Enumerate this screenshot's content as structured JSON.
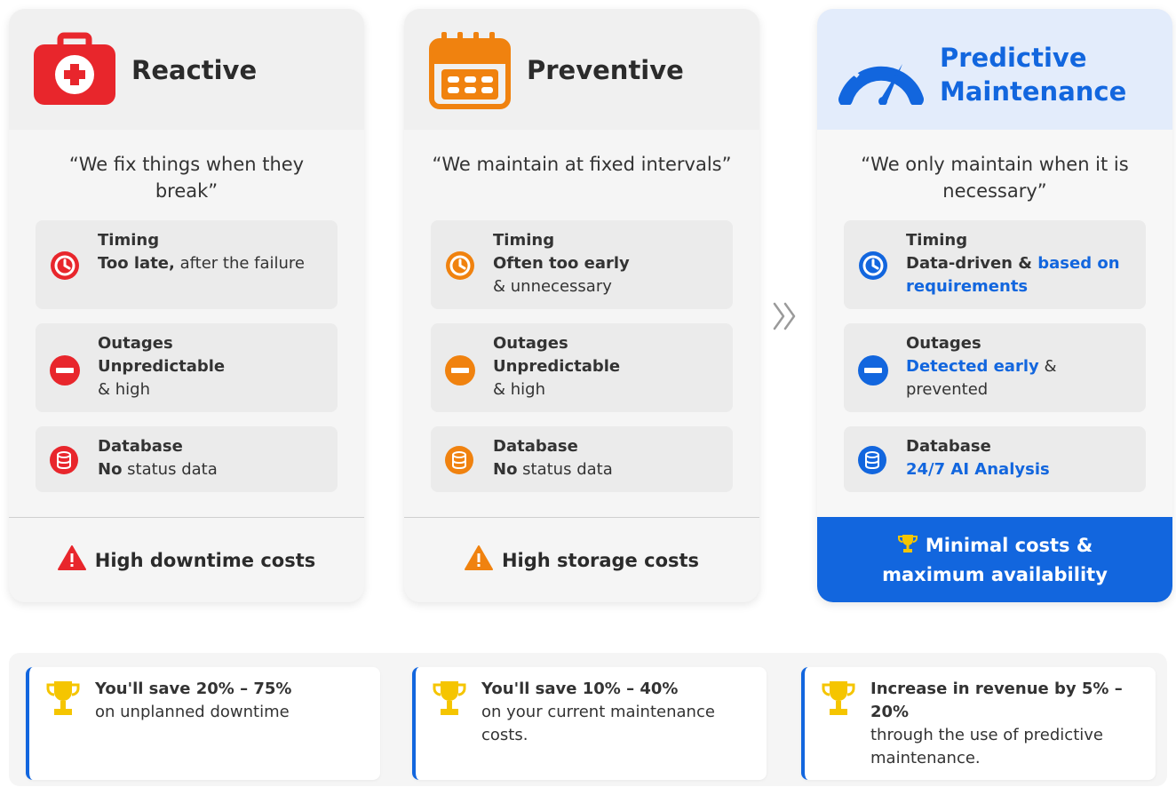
{
  "colors": {
    "reactive": "#e8262c",
    "preventive": "#f0820f",
    "predictive": "#1266de"
  },
  "cards": [
    {
      "title": "Reactive",
      "icon": "first-aid-kit-icon",
      "quote": "“We fix things when they break”",
      "timing": {
        "label": "Timing",
        "strong": "Too late,",
        "rest": " after the failure"
      },
      "outages": {
        "label": "Outages",
        "strong": "Unpredictable",
        "rest": "& high"
      },
      "database": {
        "label": "Database",
        "strong": "No",
        "rest": " status data"
      },
      "footer": "High downtime costs"
    },
    {
      "title": "Preventive",
      "icon": "calendar-icon",
      "quote": "“We maintain at fixed intervals”",
      "timing": {
        "label": "Timing",
        "strong": "Often too early",
        "rest": "& unnecessary"
      },
      "outages": {
        "label": "Outages",
        "strong": "Unpredictable",
        "rest": "& high"
      },
      "database": {
        "label": "Database",
        "strong": "No",
        "rest": " status data"
      },
      "footer": "High storage costs"
    },
    {
      "title_line1": "Predictive",
      "title_line2": "Maintenance",
      "icon": "speedometer-icon",
      "quote": "“We only maintain when it is necessary”",
      "timing": {
        "label": "Timing",
        "strong": "Data-driven & ",
        "blue": "based on requirements"
      },
      "outages": {
        "label": "Outages",
        "blue": "Detected early",
        "rest": " & prevented"
      },
      "database": {
        "label": "Database",
        "blue": "24/7 AI Analysis"
      },
      "footer_line1": "Minimal costs &",
      "footer_line2": "maximum availability"
    }
  ],
  "stats": [
    {
      "head": "You'll save 20% – 75%",
      "body": "on unplanned downtime"
    },
    {
      "head": "You'll save 10% – 40%",
      "body": "on your current maintenance costs."
    },
    {
      "head": "Increase in revenue by 5% – 20%",
      "body": "through the use of predictive maintenance."
    }
  ]
}
